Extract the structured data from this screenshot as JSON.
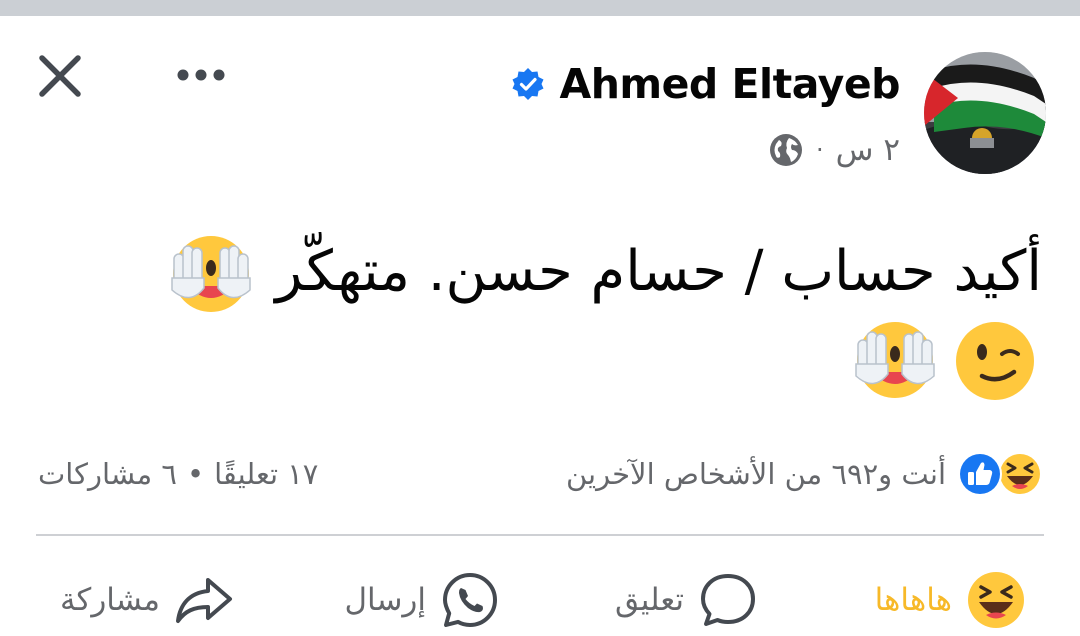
{
  "header": {
    "author_name": "Ahmed Eltayeb",
    "timestamp": "٢ س",
    "separator": "·",
    "audience_icon": "globe-icon",
    "verified_icon": "verified-badge-icon",
    "close_icon": "close-icon",
    "more_icon": "more-options-icon"
  },
  "post": {
    "text_line": "أكيد حساب / حسام حسن. متهكّر",
    "emojis_line1": [
      "face-with-hands-over-eyes"
    ],
    "emojis_line2": [
      "winking-face",
      "face-with-hands-over-eyes"
    ]
  },
  "stats": {
    "reactions_text": "أنت و٦٩٢ من الأشخاص الآخرين",
    "reaction_icons": [
      "like-icon",
      "haha-icon"
    ],
    "comments": "١٧ تعليقًا",
    "stats_separator": "•",
    "shares": "٦ مشاركات"
  },
  "actions": {
    "haha_label": "هاهاها",
    "comment_label": "تعليق",
    "send_label": "إرسال",
    "share_label": "مشاركة"
  },
  "colors": {
    "accent_blue": "#1877f2",
    "haha_yellow": "#f7b928",
    "secondary_text": "#65676b",
    "divider": "#ced0d4"
  }
}
